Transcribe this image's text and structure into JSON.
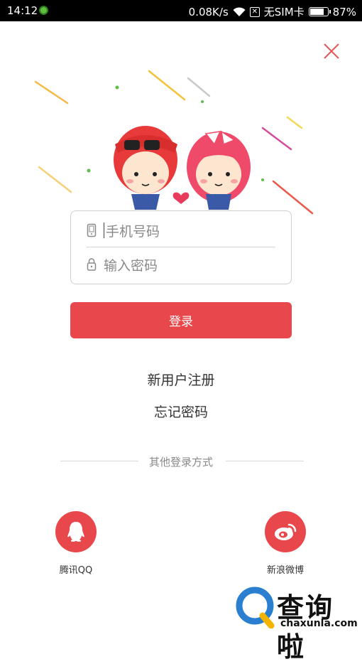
{
  "status_bar": {
    "time": "14:12",
    "network_speed": "0.08K/s",
    "sim_status": "无SIM卡",
    "battery": "87%",
    "battery_level": 0.87
  },
  "form": {
    "phone_placeholder": "手机号码",
    "password_placeholder": "输入密码",
    "login_label": "登录"
  },
  "links": {
    "register": "新用户注册",
    "forgot_password": "忘记密码"
  },
  "other_login": {
    "title": "其他登录方式",
    "providers": [
      {
        "label": "腾讯QQ",
        "icon": "qq-icon"
      },
      {
        "label": "新浪微博",
        "icon": "weibo-icon"
      }
    ]
  },
  "watermark": {
    "logo_text": "查询啦",
    "url": "chaxunla.com"
  },
  "colors": {
    "accent": "#e8474b",
    "status_bar": "#000000"
  }
}
